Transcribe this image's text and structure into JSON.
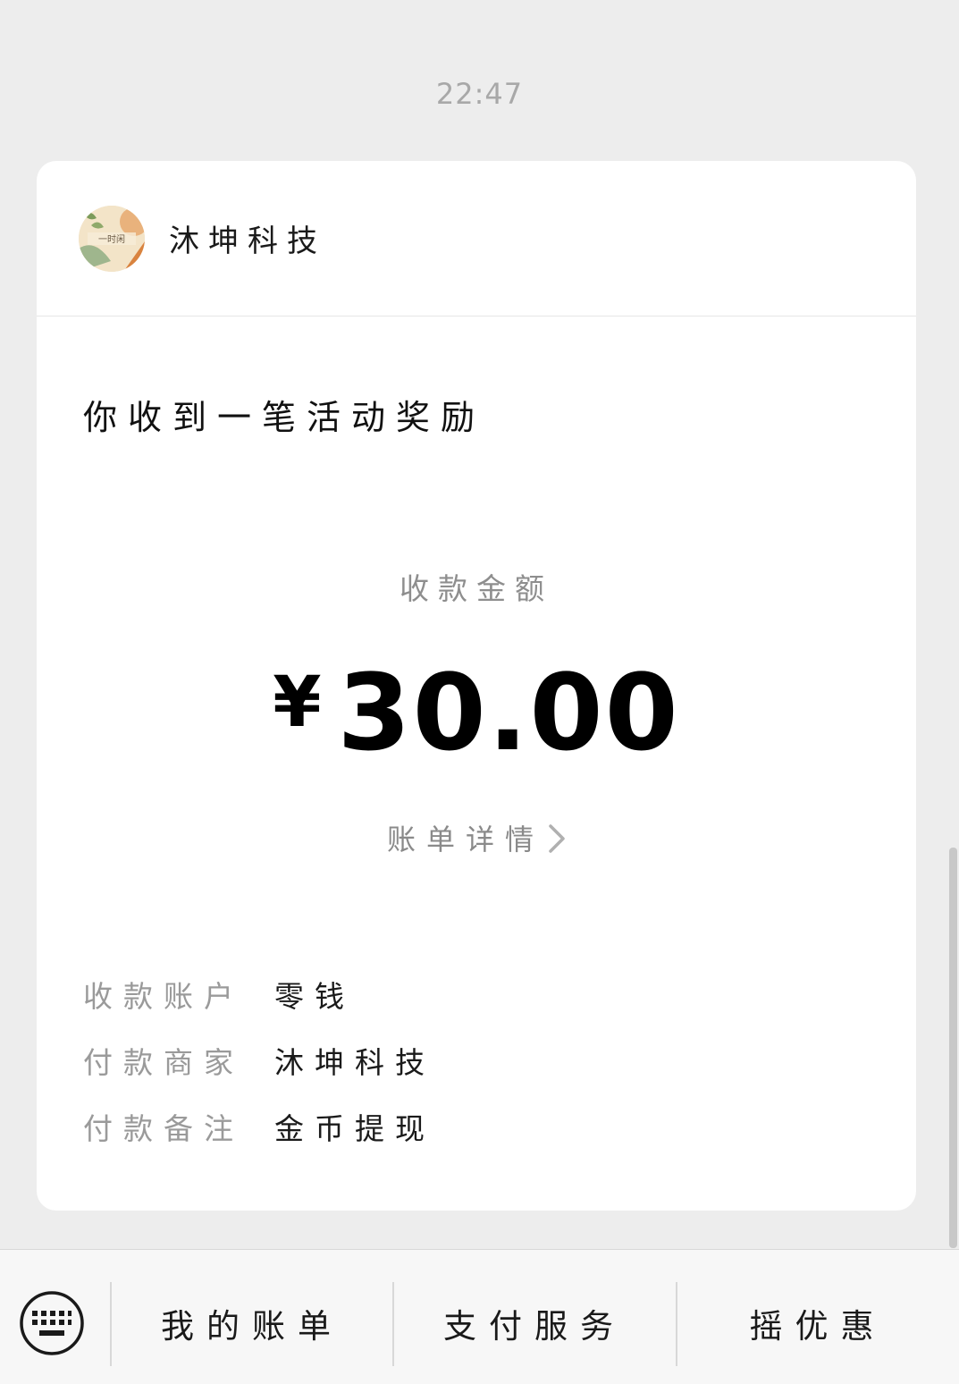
{
  "timestamp": "22:47",
  "merchant": {
    "avatar_text": "一时闲",
    "name": "沐坤科技"
  },
  "message": {
    "title": "你收到一笔活动奖励",
    "amount_label": "收款金额",
    "currency_symbol": "¥",
    "amount": "30.00",
    "bill_detail_label": "账单详情",
    "info": [
      {
        "label": "收款账户",
        "value": "零钱"
      },
      {
        "label": "付款商家",
        "value": "沐坤科技"
      },
      {
        "label": "付款备注",
        "value": "金币提现"
      }
    ]
  },
  "bottom_menu": {
    "keyboard_icon": "keyboard-icon",
    "items": [
      {
        "label": "我的账单"
      },
      {
        "label": "支付服务"
      },
      {
        "label": "摇优惠"
      }
    ]
  },
  "colors": {
    "background": "#ededed",
    "card": "#ffffff",
    "primary_text": "#111111",
    "secondary_text": "#9a9a9a"
  }
}
